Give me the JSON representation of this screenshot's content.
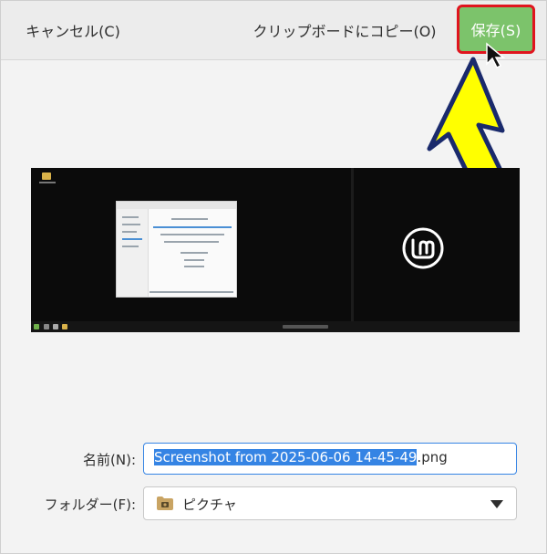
{
  "header": {
    "cancel_label": "キャンセル(C)",
    "copy_label": "クリップボードにコピー(O)",
    "save_label": "保存(S)"
  },
  "preview": {
    "icon": "linux-mint-logo"
  },
  "form": {
    "name_label": "名前(N):",
    "name_selected": "Screenshot from 2025-06-06 14-45-49",
    "name_extension": ".png",
    "folder_label": "フォルダー(F):",
    "folder_value": "ピクチャ",
    "folder_icon": "pictures-folder-icon"
  },
  "colors": {
    "save_button": "#7cc36b",
    "save_highlight": "#e0141e",
    "annotation_arrow": "#ffff00",
    "selection": "#3584e4"
  }
}
